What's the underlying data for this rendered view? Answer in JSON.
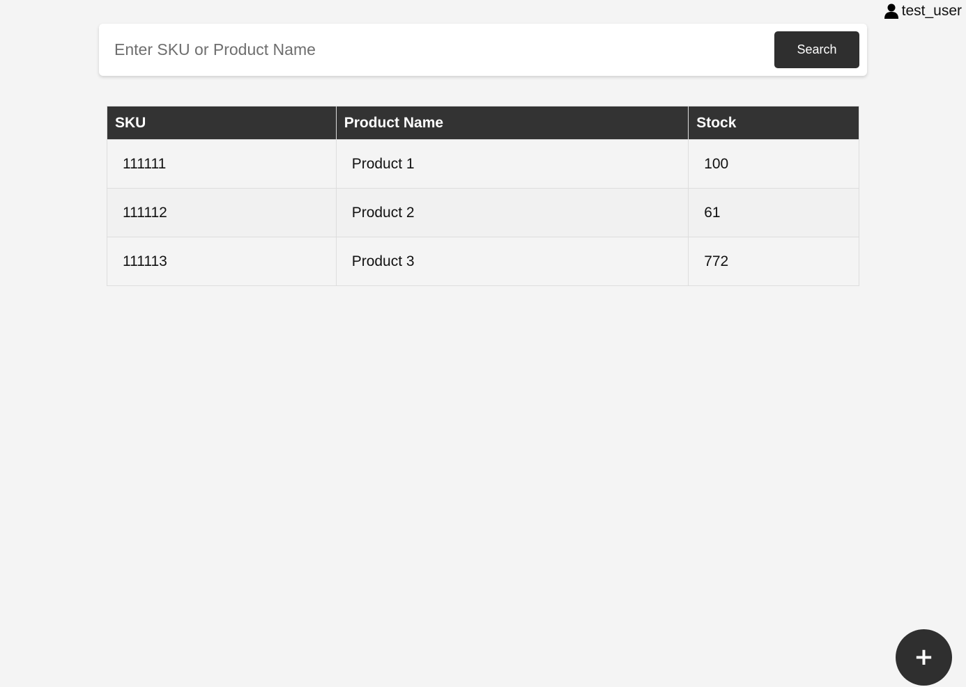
{
  "user": {
    "icon": "user-icon",
    "username": "test_user"
  },
  "search": {
    "placeholder": "Enter SKU or Product Name",
    "value": "",
    "button_label": "Search"
  },
  "table": {
    "headers": [
      "SKU",
      "Product Name",
      "Stock"
    ],
    "rows": [
      {
        "sku": "111111",
        "name": "Product 1",
        "stock": "100"
      },
      {
        "sku": "111112",
        "name": "Product 2",
        "stock": "61"
      },
      {
        "sku": "111113",
        "name": "Product 3",
        "stock": "772"
      }
    ]
  },
  "fab": {
    "icon": "plus-icon",
    "label": "+"
  },
  "colors": {
    "background": "#f4f4f4",
    "header_bg": "#333333",
    "button_bg": "#2f2f2f",
    "button_text": "#ffffff"
  }
}
